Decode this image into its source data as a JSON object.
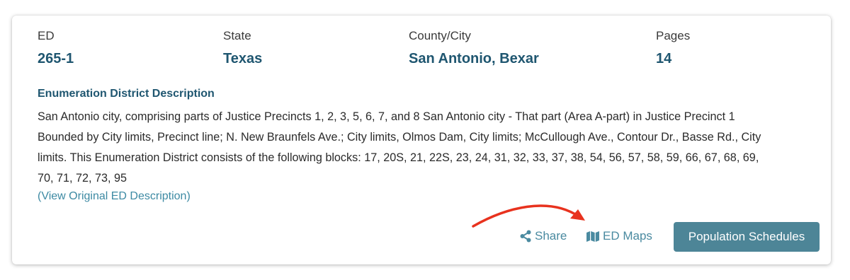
{
  "fields": [
    {
      "label": "ED",
      "value": "265-1"
    },
    {
      "label": "State",
      "value": "Texas"
    },
    {
      "label": "County/City",
      "value": "San Antonio, Bexar"
    },
    {
      "label": "Pages",
      "value": "14"
    }
  ],
  "description": {
    "heading": "Enumeration District Description",
    "text": "San Antonio city, comprising parts of Justice Precincts 1, 2, 3, 5, 6, 7, and 8 San Antonio city - That part (Area A-part) in Justice Precinct 1 Bounded by City limits, Precinct line; N. New Braunfels Ave.; City limits, Olmos Dam, City limits; McCullough Ave., Contour Dr., Basse Rd., City limits. This Enumeration District consists of the following blocks: 17, 20S, 21, 22S, 23, 24, 31, 32, 33, 37, 38, 54, 56, 57, 58, 59, 66, 67, 68, 69, 70, 71, 72, 73, 95",
    "view_link": "(View Original ED Description)"
  },
  "actions": {
    "share": "Share",
    "ed_maps": "ED Maps",
    "population_schedules": "Population Schedules"
  },
  "icons": {
    "share": "share-icon",
    "map": "map-icon",
    "annotation": "red-curved-arrow"
  },
  "colors": {
    "value_text": "#1f5670",
    "link": "#3d8aa3",
    "button_bg": "#4d8597",
    "annotation_arrow": "#e8321e"
  }
}
